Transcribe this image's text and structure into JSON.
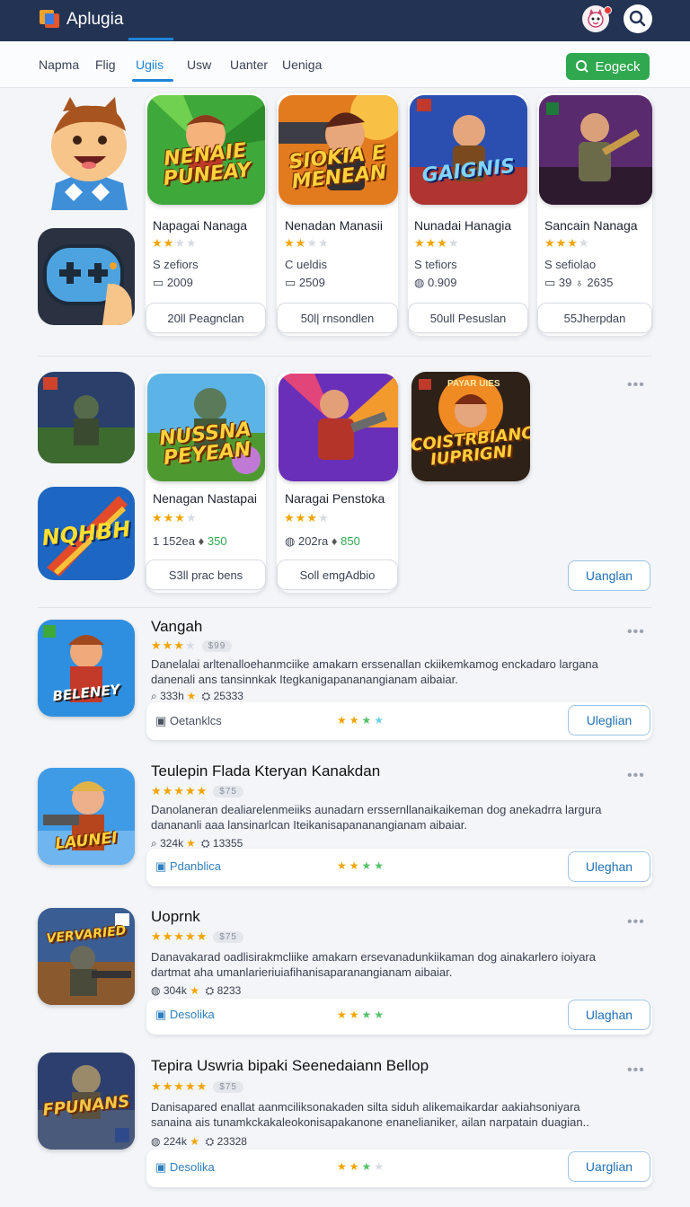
{
  "header": {
    "title": "Aplugia"
  },
  "nav": {
    "tabs": [
      "Napma",
      "Flig",
      "Ugiis",
      "Usw",
      "Uanter",
      "Ueniga"
    ],
    "action_label": "Eogeck"
  },
  "featured": [
    {
      "tile_text": "NENAIE PUNEAY",
      "name": "Napagai Nanaga",
      "rating": 2.5,
      "meta1": "S zefiors",
      "meta2": "2009",
      "button": "20ll Peagnclan"
    },
    {
      "tile_text": "SIOKIA E MENEAN",
      "name": "Nenadan Manasii",
      "rating": 2.5,
      "meta1": "C ueldis",
      "meta2": "2509",
      "button": "50l| rnsondlen"
    },
    {
      "tile_text": "GAIGNIS",
      "name": "Nunadai Hanagia",
      "rating": 3,
      "meta1": "S tefiors",
      "meta2": "0.909",
      "button": "50ull Pesuslan"
    },
    {
      "tile_text": "",
      "name": "Sancain Nanaga",
      "rating": 3,
      "meta1": "S sefiolao",
      "meta2": "39",
      "meta3": "2635",
      "button": "55Jherpdan"
    }
  ],
  "second_row": [
    {
      "tile_text": "NUSSNA PEYEAN",
      "name": "Nenagan Nastapai",
      "rating": 3,
      "stat1": "1 152ea",
      "stat2": "350",
      "button": "S3ll prac bens"
    },
    {
      "tile_text": "",
      "name": "Naragai Penstoka",
      "rating": 3,
      "stat1": "202ra",
      "stat2": "850",
      "button": "Soll emgAdbio"
    },
    {
      "tile_text": "COISTRBIANC IUPRIGNI",
      "banner": "PAYAR UIES"
    }
  ],
  "second_row_button": "Uanglan",
  "side_tile_text": "NQHBH",
  "list": [
    {
      "title": "Vangah",
      "price": "$99",
      "rating": 3,
      "desc": "Danelalai arltenalloehanmciike amakarn erssenallan ckiikemkamog enckadaro largana danenali ans tansinnkak Itegkanigapananangianam aibaiar.",
      "downloads": "333h",
      "reviews": "25333",
      "link": "Oetanklcs",
      "button": "Uleglian",
      "tile_text": "BELENEY"
    },
    {
      "title": "Teulepin Flada Kteryan Kanakdan",
      "price": "$75",
      "rating": 5,
      "desc": "Danolaneran dealiarelenmeiiks aunadarn erssernllanaikaikeman dog anekadrra largura danananli aaa lansinarlcan Iteikanisapananangianam aibaiar.",
      "downloads": "324k",
      "reviews": "13355",
      "link": "Pdanblica",
      "button": "Uleghan",
      "tile_text": "LAUNEI"
    },
    {
      "title": "Uoprnk",
      "price": "$75",
      "rating": 5,
      "desc": "Danavakarad oadlisirakmcliike amakarn ersevanadunkiikaman dog ainakarlero ioiyara dartmat aha umanlarieriuiafihanisaparanangianam aibaiar.",
      "downloads": "304k",
      "reviews": "8233",
      "link": "Desolika",
      "button": "Ulaghan",
      "tile_text": "VERVARIED"
    },
    {
      "title": "Tepira Uswria bipaki Seenedaiann Bellop",
      "price": "$75",
      "rating": 5,
      "desc": "Danisapared enallat aanmciliksonakaden silta siduh alikemaikardar aakiahsoniyara sanaina ais tunamkckakaleokonisapakanone enanelianiker, ailan narpatain duagian..",
      "downloads": "224k",
      "reviews": "23328",
      "link": "Desolika",
      "button": "Uarglian",
      "tile_text": "FPUNANS"
    }
  ],
  "colors": {
    "accent": "#1f84d8",
    "header": "#233354",
    "green": "#2fa84f",
    "star": "#f2a400"
  }
}
